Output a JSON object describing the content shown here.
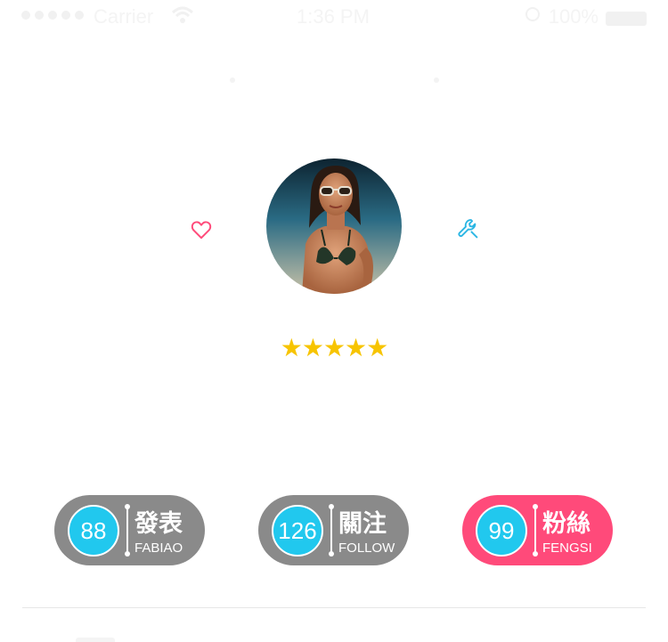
{
  "status_bar": {
    "carrier": "Carrier",
    "time": "1:36 PM",
    "battery": "100%"
  },
  "profile": {
    "rating_stars": "★★★★★",
    "rating_value": 5,
    "rating_max": 5
  },
  "stats": [
    {
      "count": "88",
      "title": "發表",
      "subtitle": "FABIAO",
      "color": "#8a8a8a"
    },
    {
      "count": "126",
      "title": "關注",
      "subtitle": "FOLLOW",
      "color": "#8a8a8a"
    },
    {
      "count": "99",
      "title": "粉絲",
      "subtitle": "FENGSI",
      "color": "#ff4a7a"
    }
  ],
  "colors": {
    "accent_cyan": "#21c8ee",
    "accent_pink": "#ff4a7a",
    "star_gold": "#f7c400",
    "heart_icon": "#ff4a7a",
    "wrench_icon": "#2bb6e4"
  },
  "icons": {
    "like": "heart-icon",
    "settings": "wrench-icon"
  }
}
